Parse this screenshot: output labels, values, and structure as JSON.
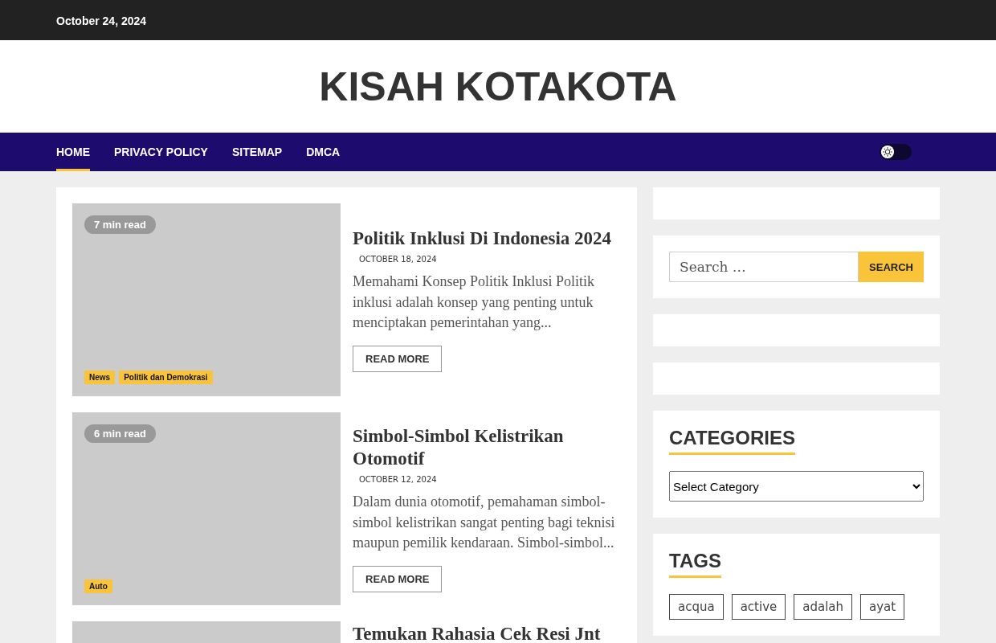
{
  "top_bar": {
    "date": "October 24, 2024"
  },
  "site_title": "KISAH KOTAKOTA",
  "nav": {
    "items": [
      {
        "label": "HOME",
        "selected": true
      },
      {
        "label": "PRIVACY POLICY",
        "selected": false
      },
      {
        "label": "SITEMAP",
        "selected": false
      },
      {
        "label": "DMCA",
        "selected": false
      }
    ],
    "dark_mode": false
  },
  "articles": [
    {
      "read_time": "7 min read",
      "categories": [
        "News",
        "Politik dan Demokrasi"
      ],
      "title": "Politik Inklusi Di Indonesia 2024",
      "date": "OCTOBER 18, 2024",
      "excerpt": "Memahami Konsep Politik Inklusi Politik inklusi adalah konsep yang penting untuk menciptakan pemerintahan yang...",
      "button": "READ MORE"
    },
    {
      "read_time": "6 min read",
      "categories": [
        "Auto"
      ],
      "title": "Simbol-Simbol Kelistrikan Otomotif",
      "date": "OCTOBER 12, 2024",
      "excerpt": "Dalam dunia otomotif, pemahaman simbol-simbol kelistrikan sangat penting bagi teknisi maupun pemilik kendaraan. Simbol-simbol...",
      "button": "READ MORE"
    },
    {
      "title": "Temukan Rahasia Cek Resi Jnt"
    }
  ],
  "sidebar": {
    "search": {
      "placeholder": "Search …",
      "button": "SEARCH"
    },
    "categories": {
      "heading": "CATEGORIES",
      "select": "Select Category"
    },
    "tags": {
      "heading": "TAGS",
      "items": [
        "acqua",
        "active",
        "adalah",
        "ayat"
      ]
    }
  }
}
